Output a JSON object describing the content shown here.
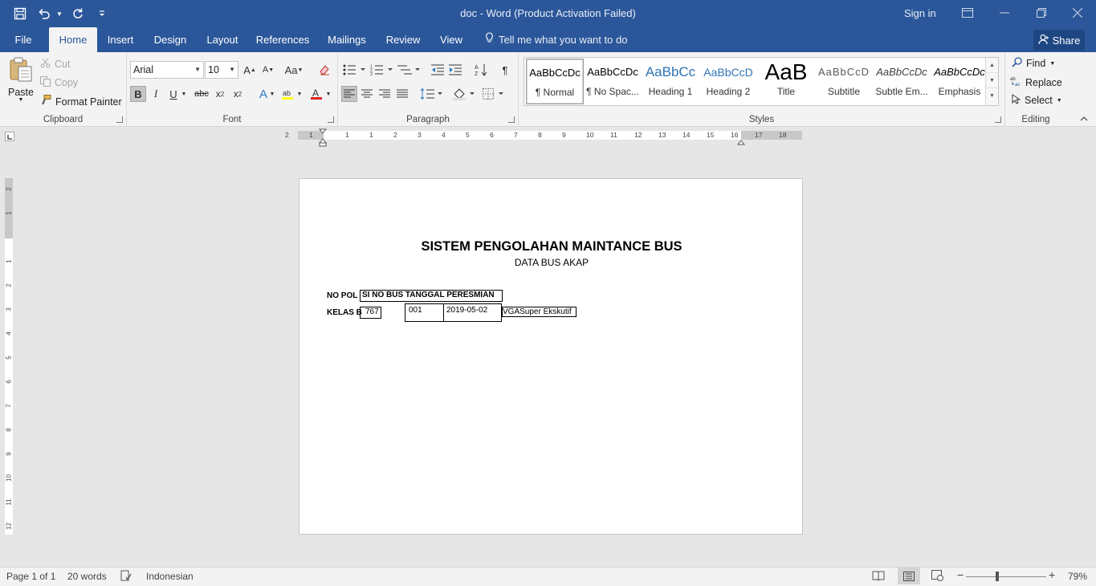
{
  "window": {
    "title": "doc  -  Word (Product Activation Failed)",
    "sign_in": "Sign in"
  },
  "tabs": [
    {
      "label": "File"
    },
    {
      "label": "Home"
    },
    {
      "label": "Insert"
    },
    {
      "label": "Design"
    },
    {
      "label": "Layout"
    },
    {
      "label": "References"
    },
    {
      "label": "Mailings"
    },
    {
      "label": "Review"
    },
    {
      "label": "View"
    }
  ],
  "active_tab": "Home",
  "tell_me": "Tell me what you want to do",
  "share": "Share",
  "clipboard": {
    "paste": "Paste",
    "cut": "Cut",
    "copy": "Copy",
    "format_painter": "Format Painter",
    "label": "Clipboard"
  },
  "font": {
    "family": "Arial",
    "size": "10",
    "label": "Font"
  },
  "paragraph": {
    "label": "Paragraph"
  },
  "styles": {
    "label": "Styles",
    "items": [
      {
        "preview": "AaBbCcDc",
        "name": "¶ Normal"
      },
      {
        "preview": "AaBbCcDc",
        "name": "¶ No Spac..."
      },
      {
        "preview": "AaBbCc",
        "name": "Heading 1"
      },
      {
        "preview": "AaBbCcD",
        "name": "Heading 2"
      },
      {
        "preview": "AaB",
        "name": "Title"
      },
      {
        "preview": "AaBbCcD",
        "name": "Subtitle"
      },
      {
        "preview": "AaBbCcDc",
        "name": "Subtle Em..."
      },
      {
        "preview": "AaBbCcDc",
        "name": "Emphasis"
      }
    ]
  },
  "editing": {
    "find": "Find",
    "replace": "Replace",
    "select": "Select",
    "label": "Editing"
  },
  "ruler": {
    "h_numbers": [
      "2",
      "1",
      "1",
      "1",
      "2",
      "3",
      "4",
      "5",
      "6",
      "7",
      "8",
      "9",
      "10",
      "11",
      "12",
      "13",
      "14",
      "15",
      "16",
      "17",
      "18"
    ],
    "v_numbers": [
      "2",
      "1",
      "1",
      "2",
      "3",
      "4",
      "5",
      "6",
      "7",
      "8",
      "9",
      "10",
      "11",
      "12"
    ]
  },
  "document": {
    "title": "SISTEM PENGOLAHAN MAINTANCE BUS",
    "subtitle": "DATA BUS AKAP",
    "label_nopol": "NO POL",
    "header_box": "SI NO BUS TANGGAL PERESMIAN",
    "label_kelas": "KELAS B",
    "cell_nopol": "767",
    "cell_nobus": "001",
    "cell_tanggal": "2019-05-02",
    "cell_kelas": "VGASuper Ekskutif"
  },
  "status": {
    "page": "Page 1 of 1",
    "words": "20 words",
    "language": "Indonesian",
    "zoom": "79%"
  }
}
